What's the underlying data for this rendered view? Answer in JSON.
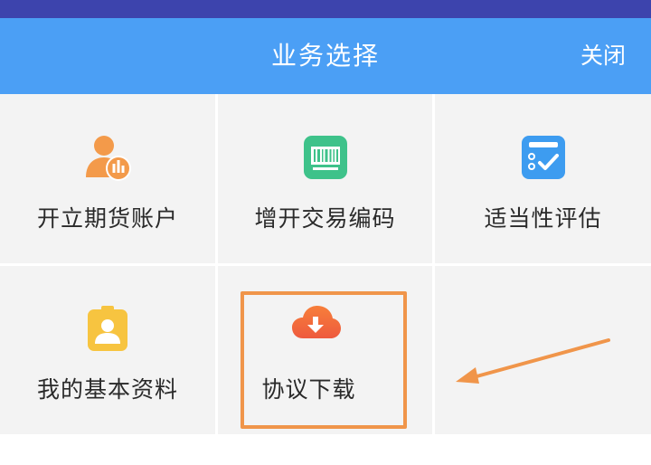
{
  "header": {
    "title": "业务选择",
    "close_label": "关闭"
  },
  "grid": {
    "items": [
      {
        "label": "开立期货账户",
        "icon": "user-chart-icon",
        "color": "#f39a4a"
      },
      {
        "label": "增开交易编码",
        "icon": "barcode-icon",
        "color": "#3ec28a"
      },
      {
        "label": "适当性评估",
        "icon": "checklist-icon",
        "color": "#3d9cf0"
      },
      {
        "label": "我的基本资料",
        "icon": "id-badge-icon",
        "color": "#f7c440"
      },
      {
        "label": "协议下载",
        "icon": "cloud-download-icon",
        "color": "#f26a3d"
      }
    ]
  },
  "annotation": {
    "highlight_color": "#f0954a",
    "arrow_color": "#f0954a"
  }
}
